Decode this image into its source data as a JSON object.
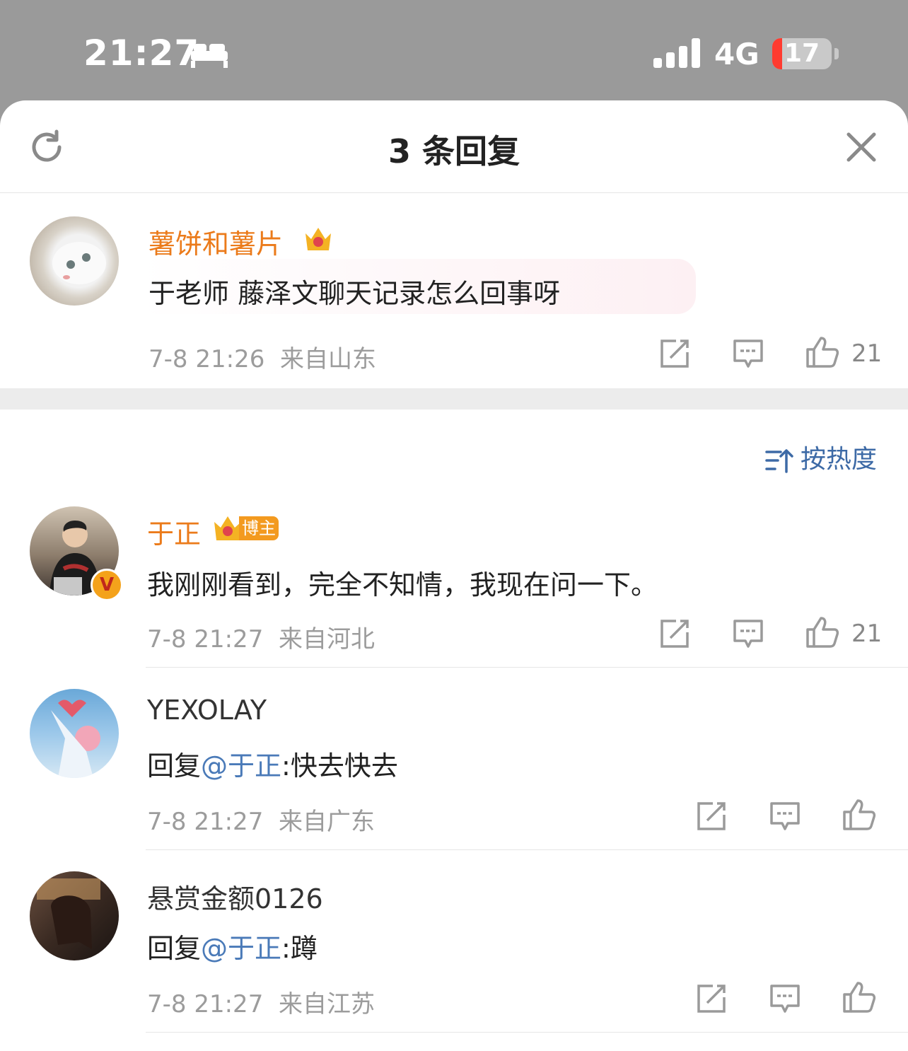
{
  "status_bar": {
    "time": "21:27",
    "network": "4G",
    "battery": "17",
    "battery_level_percent": 17
  },
  "header": {
    "title": "3 条回复",
    "refresh_icon": "refresh-icon",
    "close_icon": "close-icon"
  },
  "root_comment": {
    "author": "薯饼和薯片",
    "badge_icon": "crown-icon",
    "text": "于老师 藤泽文聊天记录怎么回事呀",
    "time": "7-8 21:26",
    "location": "来自山东",
    "likes": "21"
  },
  "sort": {
    "label": "按热度"
  },
  "replies": [
    {
      "author": "于正",
      "author_badge": "博主",
      "verified": "V",
      "text": "我刚刚看到，完全不知情，我现在问一下。",
      "time": "7-8 21:27",
      "location": "来自河北",
      "likes": "21"
    },
    {
      "author": "YEXOLAY",
      "reply_prefix": "回复",
      "mention": "@于正",
      "text": ":快去快去",
      "time": "7-8 21:27",
      "location": "来自广东",
      "likes": ""
    },
    {
      "author": "悬赏金额0126",
      "reply_prefix": "回复",
      "mention": "@于正",
      "text": ":蹲",
      "time": "7-8 21:27",
      "location": "来自江苏",
      "likes": ""
    }
  ],
  "colors": {
    "name_orange": "#eb7b1b",
    "link_blue": "#4a7ab8",
    "meta_gray": "#9c9c9c"
  }
}
